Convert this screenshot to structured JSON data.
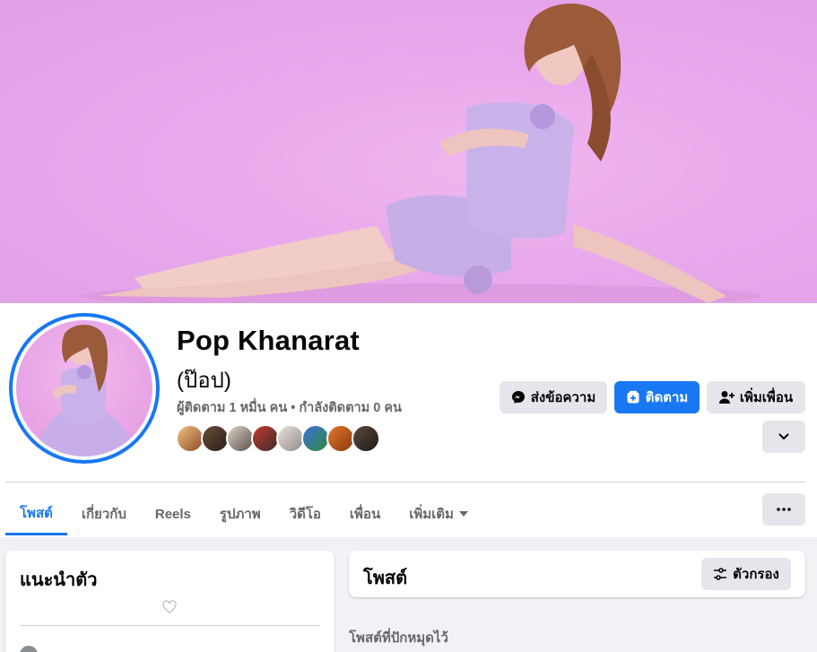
{
  "profile": {
    "name": "Pop Khanarat",
    "alt_name": "(ป๊อป)",
    "followers_text": "ผู้ติดตาม 1 หมื่น คน • กำลังติดตาม 0 คน"
  },
  "actions": {
    "message": "ส่งข้อความ",
    "follow": "ติดตาม",
    "add_friend": "เพิ่มเพื่อน"
  },
  "tabs": [
    {
      "label": "โพสต์"
    },
    {
      "label": "เกี่ยวกับ"
    },
    {
      "label": "Reels"
    },
    {
      "label": "รูปภาพ"
    },
    {
      "label": "วิดีโอ"
    },
    {
      "label": "เพื่อน"
    },
    {
      "label": "เพิ่มเติม"
    }
  ],
  "intro": {
    "title": "แนะนำตัว"
  },
  "posts": {
    "title": "โพสต์",
    "filter": "ตัวกรอง",
    "pinned_label": "โพสต์ที่ปักหมุดไว้"
  },
  "colors": {
    "accent": "#1877f2",
    "grey_button": "#e4e6eb",
    "muted_text": "#65676b"
  }
}
